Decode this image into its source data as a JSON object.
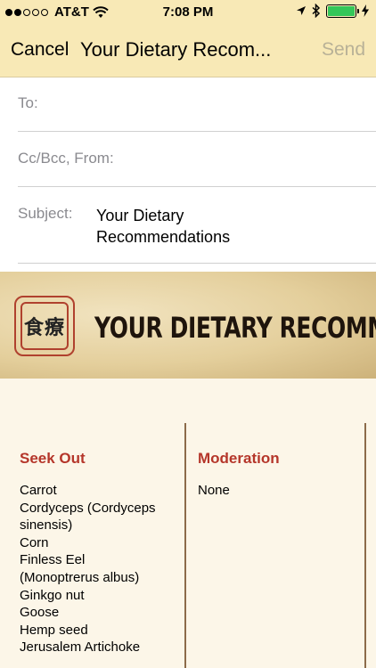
{
  "status_bar": {
    "carrier": "AT&T",
    "time": "7:08 PM",
    "signal_filled": 2,
    "battery_level": 1.0
  },
  "nav": {
    "cancel_label": "Cancel",
    "title": "Your Dietary Recom...",
    "send_label": "Send"
  },
  "fields": {
    "to_label": "To:",
    "cc_label": "Cc/Bcc, From:",
    "subject_label": "Subject:",
    "subject_value_line1": "Your Dietary",
    "subject_value_line2": "Recommendations"
  },
  "banner": {
    "seal_text": "食療",
    "title": "YOUR DIETARY RECOMMENDATIONS"
  },
  "columns": {
    "seek_out": {
      "heading": "Seek Out",
      "items": [
        "Carrot",
        "Cordyceps (Cordyceps",
        "sinensis)",
        "Corn",
        "Finless Eel",
        "(Monoptrerus albus)",
        "Ginkgo nut",
        "Goose",
        "Hemp seed",
        "Jerusalem Artichoke"
      ]
    },
    "moderation": {
      "heading": "Moderation",
      "items": [
        "None"
      ]
    }
  },
  "colors": {
    "bar": "#f8e9b6",
    "heading_red": "#b5362a",
    "battery_green": "#34c759"
  }
}
